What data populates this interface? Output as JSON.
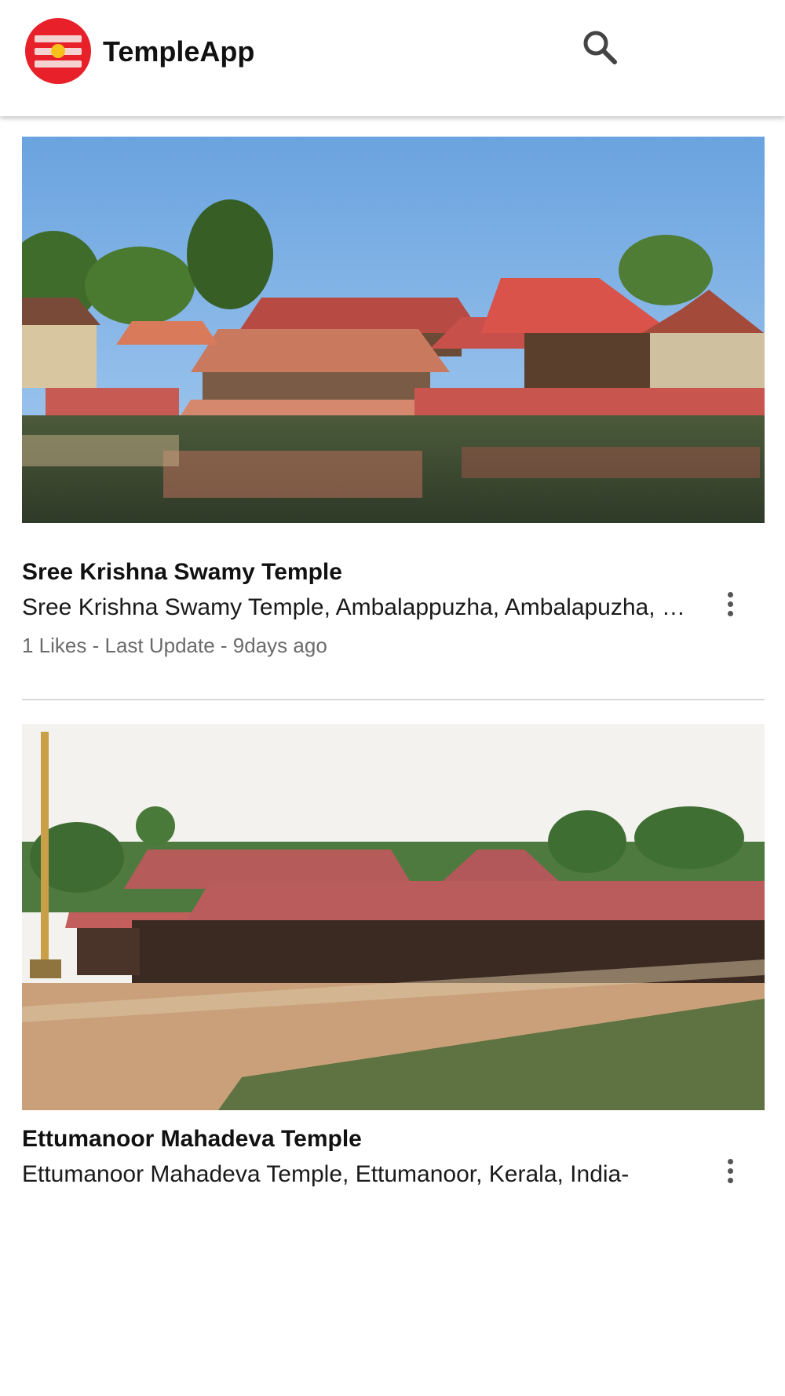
{
  "app": {
    "title": "TempleApp",
    "brand_color": "#e8202a",
    "logo_icon": "temple-logo-icon",
    "search_icon": "search-icon"
  },
  "temples": [
    {
      "name": "Sree Krishna Swamy Temple",
      "address": "Sree Krishna Swamy Temple, Ambalappuzha, Ambalapuzha, Kerala, India",
      "meta": "1 Likes - Last Update - 9days ago",
      "image_icon": "temple-photo"
    },
    {
      "name": "Ettumanoor Mahadeva Temple",
      "address": "Ettumanoor Mahadeva Temple, Ettumanoor, Kerala, India-",
      "meta": "",
      "image_icon": "temple-photo"
    }
  ]
}
